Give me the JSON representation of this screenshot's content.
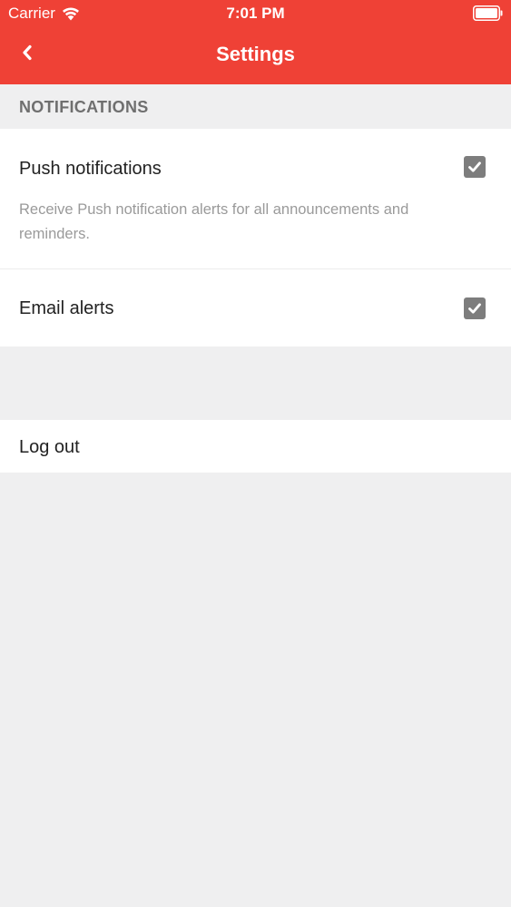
{
  "status_bar": {
    "carrier": "Carrier",
    "time": "7:01 PM",
    "wifi_icon": "wifi-icon",
    "battery_icon": "battery-icon"
  },
  "nav": {
    "title": "Settings",
    "back_icon": "chevron-left-icon"
  },
  "colors": {
    "accent": "#ef4136",
    "background": "#efeff0",
    "checkbox": "#7d7d7d"
  },
  "notifications": {
    "section_title": "NOTIFICATIONS",
    "push": {
      "label": "Push notifications",
      "description": "Receive Push notification alerts for all announcements and reminders.",
      "checked": true
    },
    "email": {
      "label": "Email alerts",
      "checked": true
    }
  },
  "account": {
    "logout_label": "Log out"
  }
}
